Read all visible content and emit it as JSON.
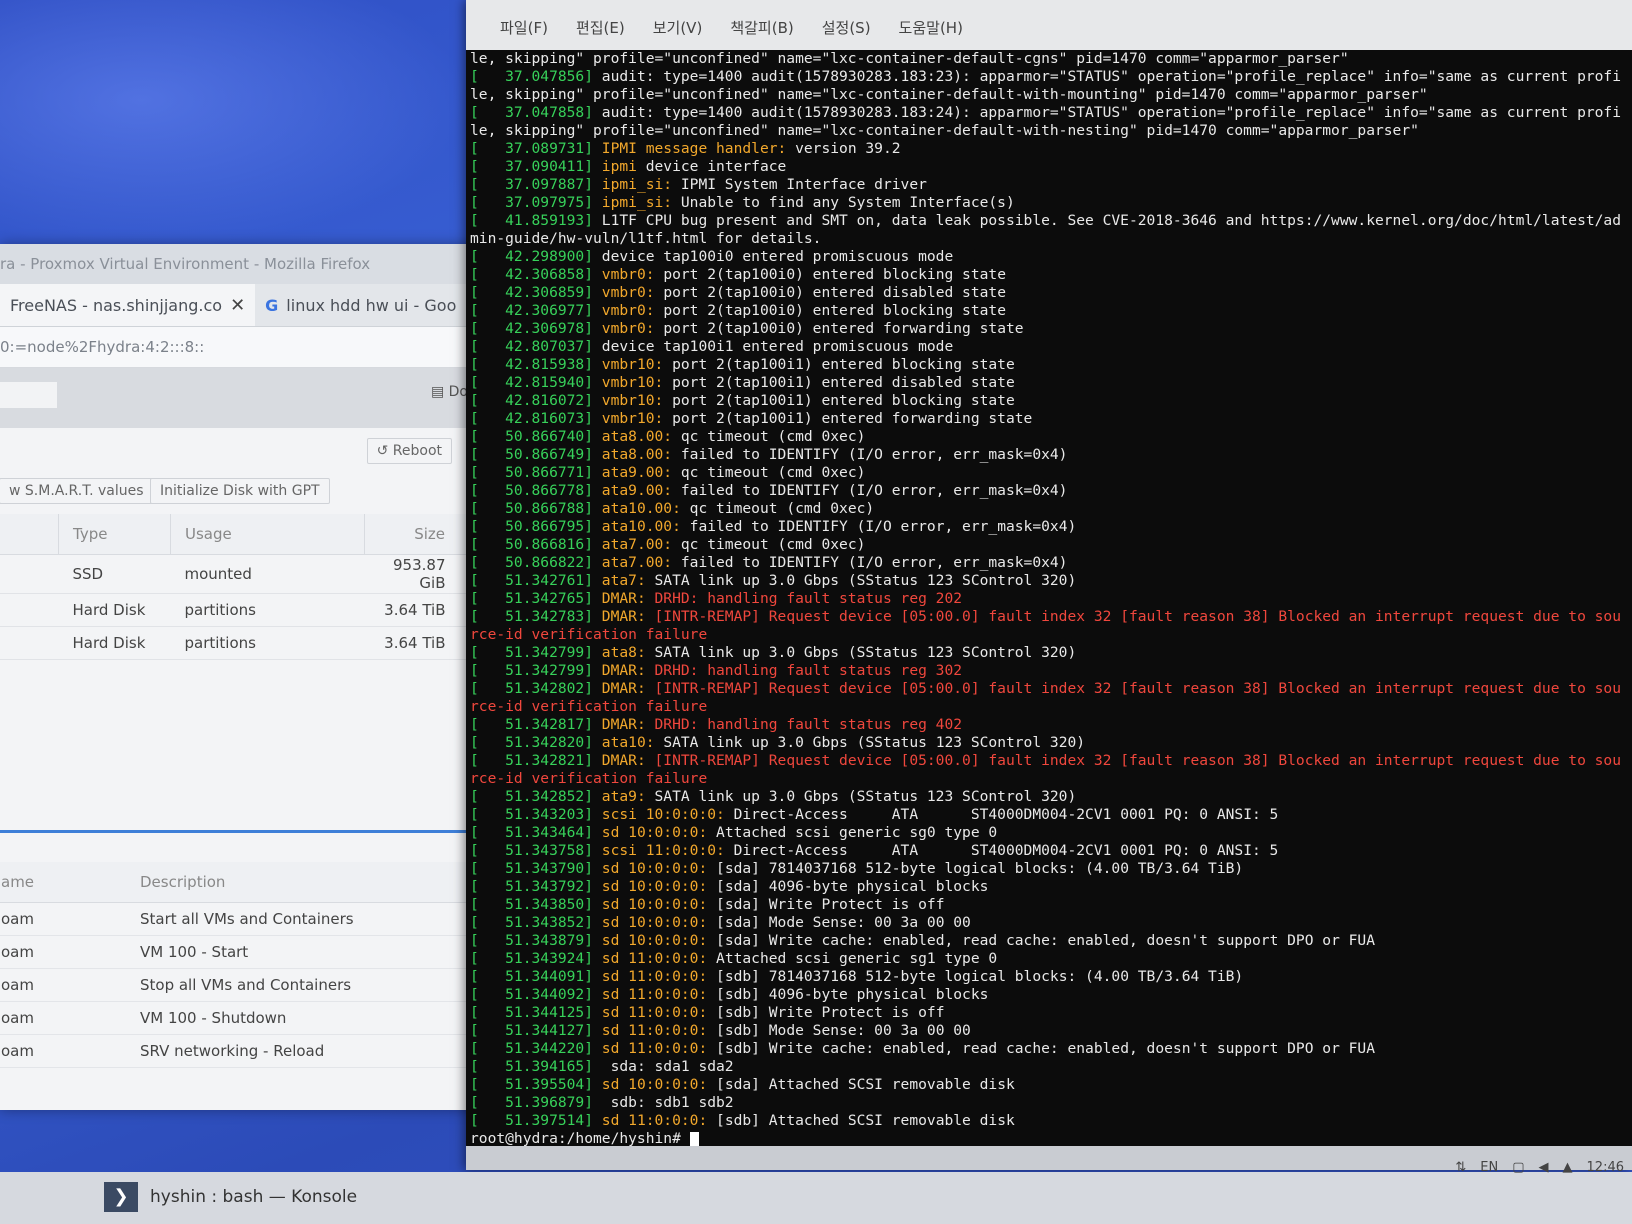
{
  "firefox": {
    "title": "ra - Proxmox Virtual Environment - Mozilla Firefox",
    "tabs": [
      {
        "label": "FreeNAS - nas.shinjjang.co",
        "close": "✕"
      },
      {
        "label": "linux hdd hw ui - Goo"
      }
    ],
    "url": "0:=node%2Fhydra:4:2:::8::",
    "doc_label": "Do",
    "reboot_label": "Reboot",
    "smart_label": "w S.M.A.R.T. values",
    "init_disk_label": "Initialize Disk with GPT",
    "disk_columns": [
      "Type",
      "Usage",
      "Size"
    ],
    "disks": [
      {
        "type": "SSD",
        "usage": "mounted",
        "size": "953.87 GiB"
      },
      {
        "type": "Hard Disk",
        "usage": "partitions",
        "size": "3.64 TiB"
      },
      {
        "type": "Hard Disk",
        "usage": "partitions",
        "size": "3.64 TiB"
      }
    ],
    "task_columns": [
      "ame",
      "Description"
    ],
    "tasks": [
      {
        "name": "oam",
        "desc": "Start all VMs and Containers"
      },
      {
        "name": "oam",
        "desc": "VM 100 - Start"
      },
      {
        "name": "oam",
        "desc": "Stop all VMs and Containers"
      },
      {
        "name": "oam",
        "desc": "VM 100 - Shutdown"
      },
      {
        "name": "oam",
        "desc": "SRV networking - Reload"
      }
    ]
  },
  "konsole": {
    "menu": [
      "파일(F)",
      "편집(E)",
      "보기(V)",
      "책갈피(B)",
      "설정(S)",
      "도움말(H)"
    ],
    "lines": [
      {
        "p": "le, skipping\" profile=\"unconfined\" name=\"lxc-container-default-cgns\" pid=1470 comm=\"apparmor_parser\""
      },
      {
        "ts": "[   37.047856]",
        "r": " audit: type=1400 audit(1578930283.183:23): apparmor=\"STATUS\" operation=\"profile_replace\" info=\"same as current profi"
      },
      {
        "p": "le, skipping\" profile=\"unconfined\" name=\"lxc-container-default-with-mounting\" pid=1470 comm=\"apparmor_parser\""
      },
      {
        "ts": "[   37.047858]",
        "r": " audit: type=1400 audit(1578930283.183:24): apparmor=\"STATUS\" operation=\"profile_replace\" info=\"same as current profi"
      },
      {
        "p": "le, skipping\" profile=\"unconfined\" name=\"lxc-container-default-with-nesting\" pid=1470 comm=\"apparmor_parser\""
      },
      {
        "ts": "[   37.089731]",
        "tag": " IPMI message handler:",
        "r": " version 39.2"
      },
      {
        "ts": "[   37.090411]",
        "tag": " ipmi",
        "r": " device interface"
      },
      {
        "ts": "[   37.097887]",
        "tag": " ipmi_si:",
        "r": " IPMI System Interface driver"
      },
      {
        "ts": "[   37.097975]",
        "tag": " ipmi_si:",
        "r": " Unable to find any System Interface(s)"
      },
      {
        "ts": "[   41.859193]",
        "r": " L1TF CPU bug present and SMT on, data leak possible. See CVE-2018-3646 and https://www.kernel.org/doc/html/latest/ad"
      },
      {
        "p": "min-guide/hw-vuln/l1tf.html for details."
      },
      {
        "ts": "[   42.298900]",
        "r": " device tap100i0 entered promiscuous mode"
      },
      {
        "ts": "[   42.306858]",
        "tag": " vmbr0:",
        "r": " port 2(tap100i0) entered blocking state"
      },
      {
        "ts": "[   42.306859]",
        "tag": " vmbr0:",
        "r": " port 2(tap100i0) entered disabled state"
      },
      {
        "ts": "[   42.306977]",
        "tag": " vmbr0:",
        "r": " port 2(tap100i0) entered blocking state"
      },
      {
        "ts": "[   42.306978]",
        "tag": " vmbr0:",
        "r": " port 2(tap100i0) entered forwarding state"
      },
      {
        "ts": "[   42.807037]",
        "r": " device tap100i1 entered promiscuous mode"
      },
      {
        "ts": "[   42.815938]",
        "tag": " vmbr10:",
        "r": " port 2(tap100i1) entered blocking state"
      },
      {
        "ts": "[   42.815940]",
        "tag": " vmbr10:",
        "r": " port 2(tap100i1) entered disabled state"
      },
      {
        "ts": "[   42.816072]",
        "tag": " vmbr10:",
        "r": " port 2(tap100i1) entered blocking state"
      },
      {
        "ts": "[   42.816073]",
        "tag": " vmbr10:",
        "r": " port 2(tap100i1) entered forwarding state"
      },
      {
        "ts": "[   50.866740]",
        "tag": " ata8.00:",
        "r": " qc timeout (cmd 0xec)"
      },
      {
        "ts": "[   50.866749]",
        "tag": " ata8.00:",
        "r": " failed to IDENTIFY (I/O error, err_mask=0x4)"
      },
      {
        "ts": "[   50.866771]",
        "tag": " ata9.00:",
        "r": " qc timeout (cmd 0xec)"
      },
      {
        "ts": "[   50.866778]",
        "tag": " ata9.00:",
        "r": " failed to IDENTIFY (I/O error, err_mask=0x4)"
      },
      {
        "ts": "[   50.866788]",
        "tag": " ata10.00:",
        "r": " qc timeout (cmd 0xec)"
      },
      {
        "ts": "[   50.866795]",
        "tag": " ata10.00:",
        "r": " failed to IDENTIFY (I/O error, err_mask=0x4)"
      },
      {
        "ts": "[   50.866816]",
        "tag": " ata7.00:",
        "r": " qc timeout (cmd 0xec)"
      },
      {
        "ts": "[   50.866822]",
        "tag": " ata7.00:",
        "r": " failed to IDENTIFY (I/O error, err_mask=0x4)"
      },
      {
        "ts": "[   51.342761]",
        "tag": " ata7:",
        "r": " SATA link up 3.0 Gbps (SStatus 123 SControl 320)"
      },
      {
        "ts": "[   51.342765]",
        "tag": " DMAR:",
        "e": " DRHD: handling fault status reg 202"
      },
      {
        "ts": "[   51.342783]",
        "tag": " DMAR:",
        "e": " [INTR-REMAP] Request device [05:00.0] fault index 32 [fault reason 38] Blocked an interrupt request due to sou"
      },
      {
        "pe": "rce-id verification failure"
      },
      {
        "ts": "[   51.342799]",
        "tag": " ata8:",
        "r": " SATA link up 3.0 Gbps (SStatus 123 SControl 320)"
      },
      {
        "ts": "[   51.342799]",
        "tag": " DMAR:",
        "e": " DRHD: handling fault status reg 302"
      },
      {
        "ts": "[   51.342802]",
        "tag": " DMAR:",
        "e": " [INTR-REMAP] Request device [05:00.0] fault index 32 [fault reason 38] Blocked an interrupt request due to sou"
      },
      {
        "pe": "rce-id verification failure"
      },
      {
        "ts": "[   51.342817]",
        "tag": " DMAR:",
        "e": " DRHD: handling fault status reg 402"
      },
      {
        "ts": "[   51.342820]",
        "tag": " ata10:",
        "r": " SATA link up 3.0 Gbps (SStatus 123 SControl 320)"
      },
      {
        "ts": "[   51.342821]",
        "tag": " DMAR:",
        "e": " [INTR-REMAP] Request device [05:00.0] fault index 32 [fault reason 38] Blocked an interrupt request due to sou"
      },
      {
        "pe": "rce-id verification failure"
      },
      {
        "ts": "[   51.342852]",
        "tag": " ata9:",
        "r": " SATA link up 3.0 Gbps (SStatus 123 SControl 320)"
      },
      {
        "ts": "[   51.343203]",
        "tag": " scsi 10:0:0:0:",
        "r": " Direct-Access     ATA      ST4000DM004-2CV1 0001 PQ: 0 ANSI: 5"
      },
      {
        "ts": "[   51.343464]",
        "tag": " sd 10:0:0:0:",
        "r": " Attached scsi generic sg0 type 0"
      },
      {
        "ts": "[   51.343758]",
        "tag": " scsi 11:0:0:0:",
        "r": " Direct-Access     ATA      ST4000DM004-2CV1 0001 PQ: 0 ANSI: 5"
      },
      {
        "ts": "[   51.343790]",
        "tag": " sd 10:0:0:0:",
        "r": " [sda] 7814037168 512-byte logical blocks: (4.00 TB/3.64 TiB)"
      },
      {
        "ts": "[   51.343792]",
        "tag": " sd 10:0:0:0:",
        "r": " [sda] 4096-byte physical blocks"
      },
      {
        "ts": "[   51.343850]",
        "tag": " sd 10:0:0:0:",
        "r": " [sda] Write Protect is off"
      },
      {
        "ts": "[   51.343852]",
        "tag": " sd 10:0:0:0:",
        "r": " [sda] Mode Sense: 00 3a 00 00"
      },
      {
        "ts": "[   51.343879]",
        "tag": " sd 10:0:0:0:",
        "r": " [sda] Write cache: enabled, read cache: enabled, doesn't support DPO or FUA"
      },
      {
        "ts": "[   51.343924]",
        "tag": " sd 11:0:0:0:",
        "r": " Attached scsi generic sg1 type 0"
      },
      {
        "ts": "[   51.344091]",
        "tag": " sd 11:0:0:0:",
        "r": " [sdb] 7814037168 512-byte logical blocks: (4.00 TB/3.64 TiB)"
      },
      {
        "ts": "[   51.344092]",
        "tag": " sd 11:0:0:0:",
        "r": " [sdb] 4096-byte physical blocks"
      },
      {
        "ts": "[   51.344125]",
        "tag": " sd 11:0:0:0:",
        "r": " [sdb] Write Protect is off"
      },
      {
        "ts": "[   51.344127]",
        "tag": " sd 11:0:0:0:",
        "r": " [sdb] Mode Sense: 00 3a 00 00"
      },
      {
        "ts": "[   51.344220]",
        "tag": " sd 11:0:0:0:",
        "r": " [sdb] Write cache: enabled, read cache: enabled, doesn't support DPO or FUA"
      },
      {
        "ts": "[   51.394165]",
        "r": "  sda: sda1 sda2"
      },
      {
        "ts": "[   51.395504]",
        "tag": " sd 10:0:0:0:",
        "r": " [sda] Attached SCSI removable disk"
      },
      {
        "ts": "[   51.396879]",
        "r": "  sdb: sdb1 sdb2"
      },
      {
        "ts": "[   51.397514]",
        "tag": " sd 11:0:0:0:",
        "r": " [sdb] Attached SCSI removable disk"
      }
    ],
    "prompt": "root@hydra:/home/hyshin# "
  },
  "taskbar": {
    "task_label": "hyshin : bash — Konsole",
    "lang": "EN",
    "clock": "12:46"
  }
}
